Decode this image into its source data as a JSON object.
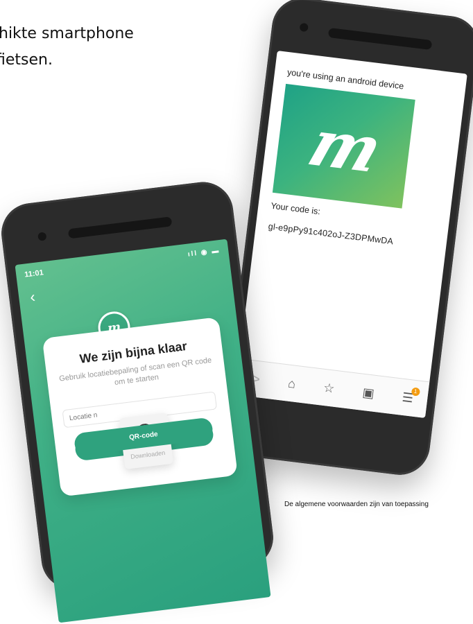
{
  "background": {
    "line1": "hikte smartphone",
    "line2": "fietsen."
  },
  "android": {
    "message": "you're using an android device",
    "code_label": "Your code is:",
    "code": "gl-e9pPy91c402oJ-Z3DPMwDA",
    "nav": {
      "back": ">",
      "home": "⌂",
      "star": "☆",
      "tabs": "▣",
      "menu": "☰",
      "badge": "1"
    }
  },
  "ios": {
    "status_time": "11:01",
    "status_icons": "ıll ◉ ▬",
    "back": "‹",
    "logo_letter": "m",
    "title": "We zijn bijna klaar",
    "subtitle": "Gebruik locatiebepaling of scan een QR code om te starten",
    "input_placeholder": "Locatie n",
    "spinner_label": "Downloaden",
    "qr_button": "QR-code"
  },
  "footer": {
    "terms": "De algemene voorwaarden zijn van toepassing"
  },
  "colors": {
    "brand_green": "#2fa27e",
    "gradient_start": "#1fa286",
    "gradient_end": "#7fc25e",
    "badge": "#f39c12"
  }
}
